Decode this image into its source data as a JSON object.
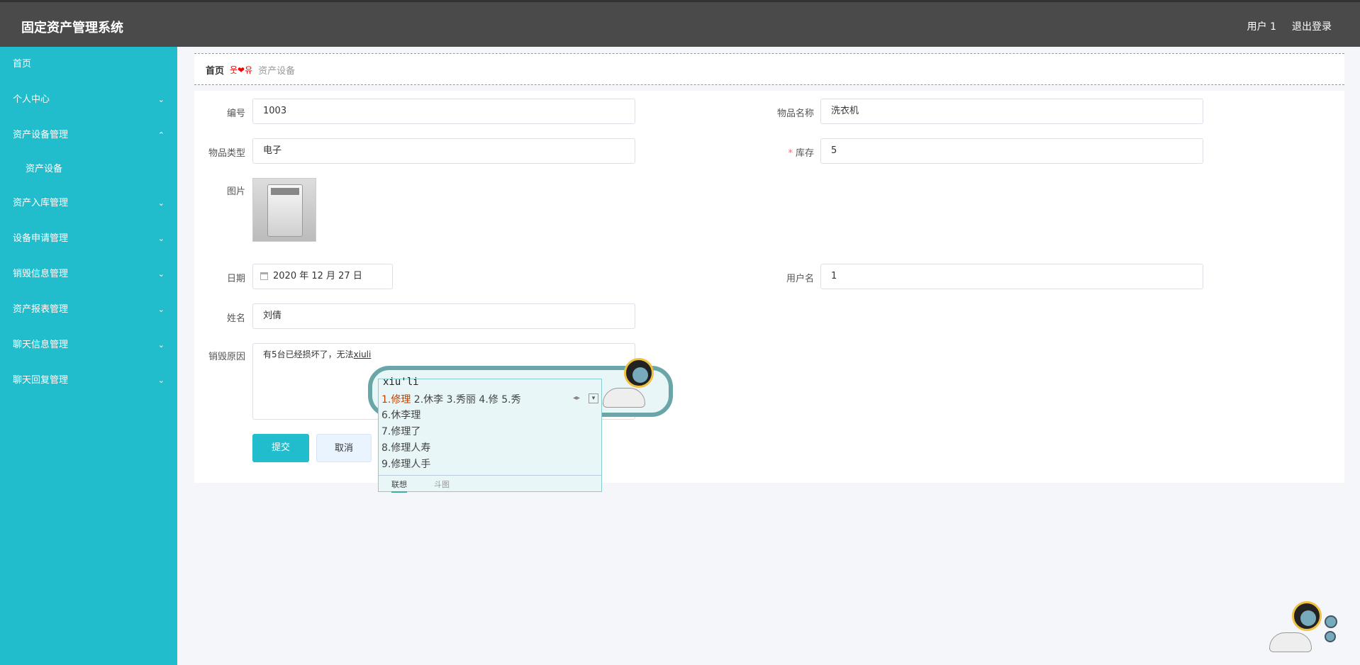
{
  "app": {
    "title": "固定资产管理系统"
  },
  "topbar": {
    "user": "用户 1",
    "logout": "退出登录"
  },
  "sidebar": {
    "items": [
      {
        "label": "首页",
        "chevron": ""
      },
      {
        "label": "个人中心",
        "chevron": "⌄"
      },
      {
        "label": "资产设备管理",
        "chevron": "⌃"
      },
      {
        "label": "资产入库管理",
        "chevron": "⌄"
      },
      {
        "label": "设备申请管理",
        "chevron": "⌄"
      },
      {
        "label": "销毁信息管理",
        "chevron": "⌄"
      },
      {
        "label": "资产报表管理",
        "chevron": "⌄"
      },
      {
        "label": "聊天信息管理",
        "chevron": "⌄"
      },
      {
        "label": "聊天回复管理",
        "chevron": "⌄"
      }
    ],
    "sub": {
      "label": "资产设备"
    }
  },
  "breadcrumb": {
    "home": "首页",
    "sep": "웃❤유",
    "current": "资产设备"
  },
  "form": {
    "code": {
      "label": "编号",
      "value": "1003"
    },
    "name": {
      "label": "物品名称",
      "value": "洗衣机"
    },
    "type": {
      "label": "物品类型",
      "value": "电子"
    },
    "stock": {
      "label": "库存",
      "required": "*",
      "value": "5"
    },
    "image": {
      "label": "图片"
    },
    "date": {
      "label": "日期",
      "value": "2020 年 12 月 27 日"
    },
    "username": {
      "label": "用户名",
      "value": "1"
    },
    "realname": {
      "label": "姓名",
      "value": "刘倩"
    },
    "reason": {
      "label": "销毁原因",
      "prefix": "有5台已经损坏了，无法",
      "typed": "xiuli"
    },
    "submit": "提交",
    "cancel": "取消"
  },
  "ime": {
    "pinyin": "xiu'li",
    "first": "1.修理",
    "row1_rest": " 2.休李  3.秀丽  4.修  5.秀",
    "more": [
      "6.休李理",
      "7.修理了",
      "8.修理人寿",
      "9.修理人手"
    ],
    "tabs": {
      "active": "联想",
      "inactive": "斗图"
    },
    "arrows": "◂▸",
    "expand": "▾"
  },
  "colors": {
    "accent": "#21bdcc",
    "topbar": "#4a4a4a"
  }
}
